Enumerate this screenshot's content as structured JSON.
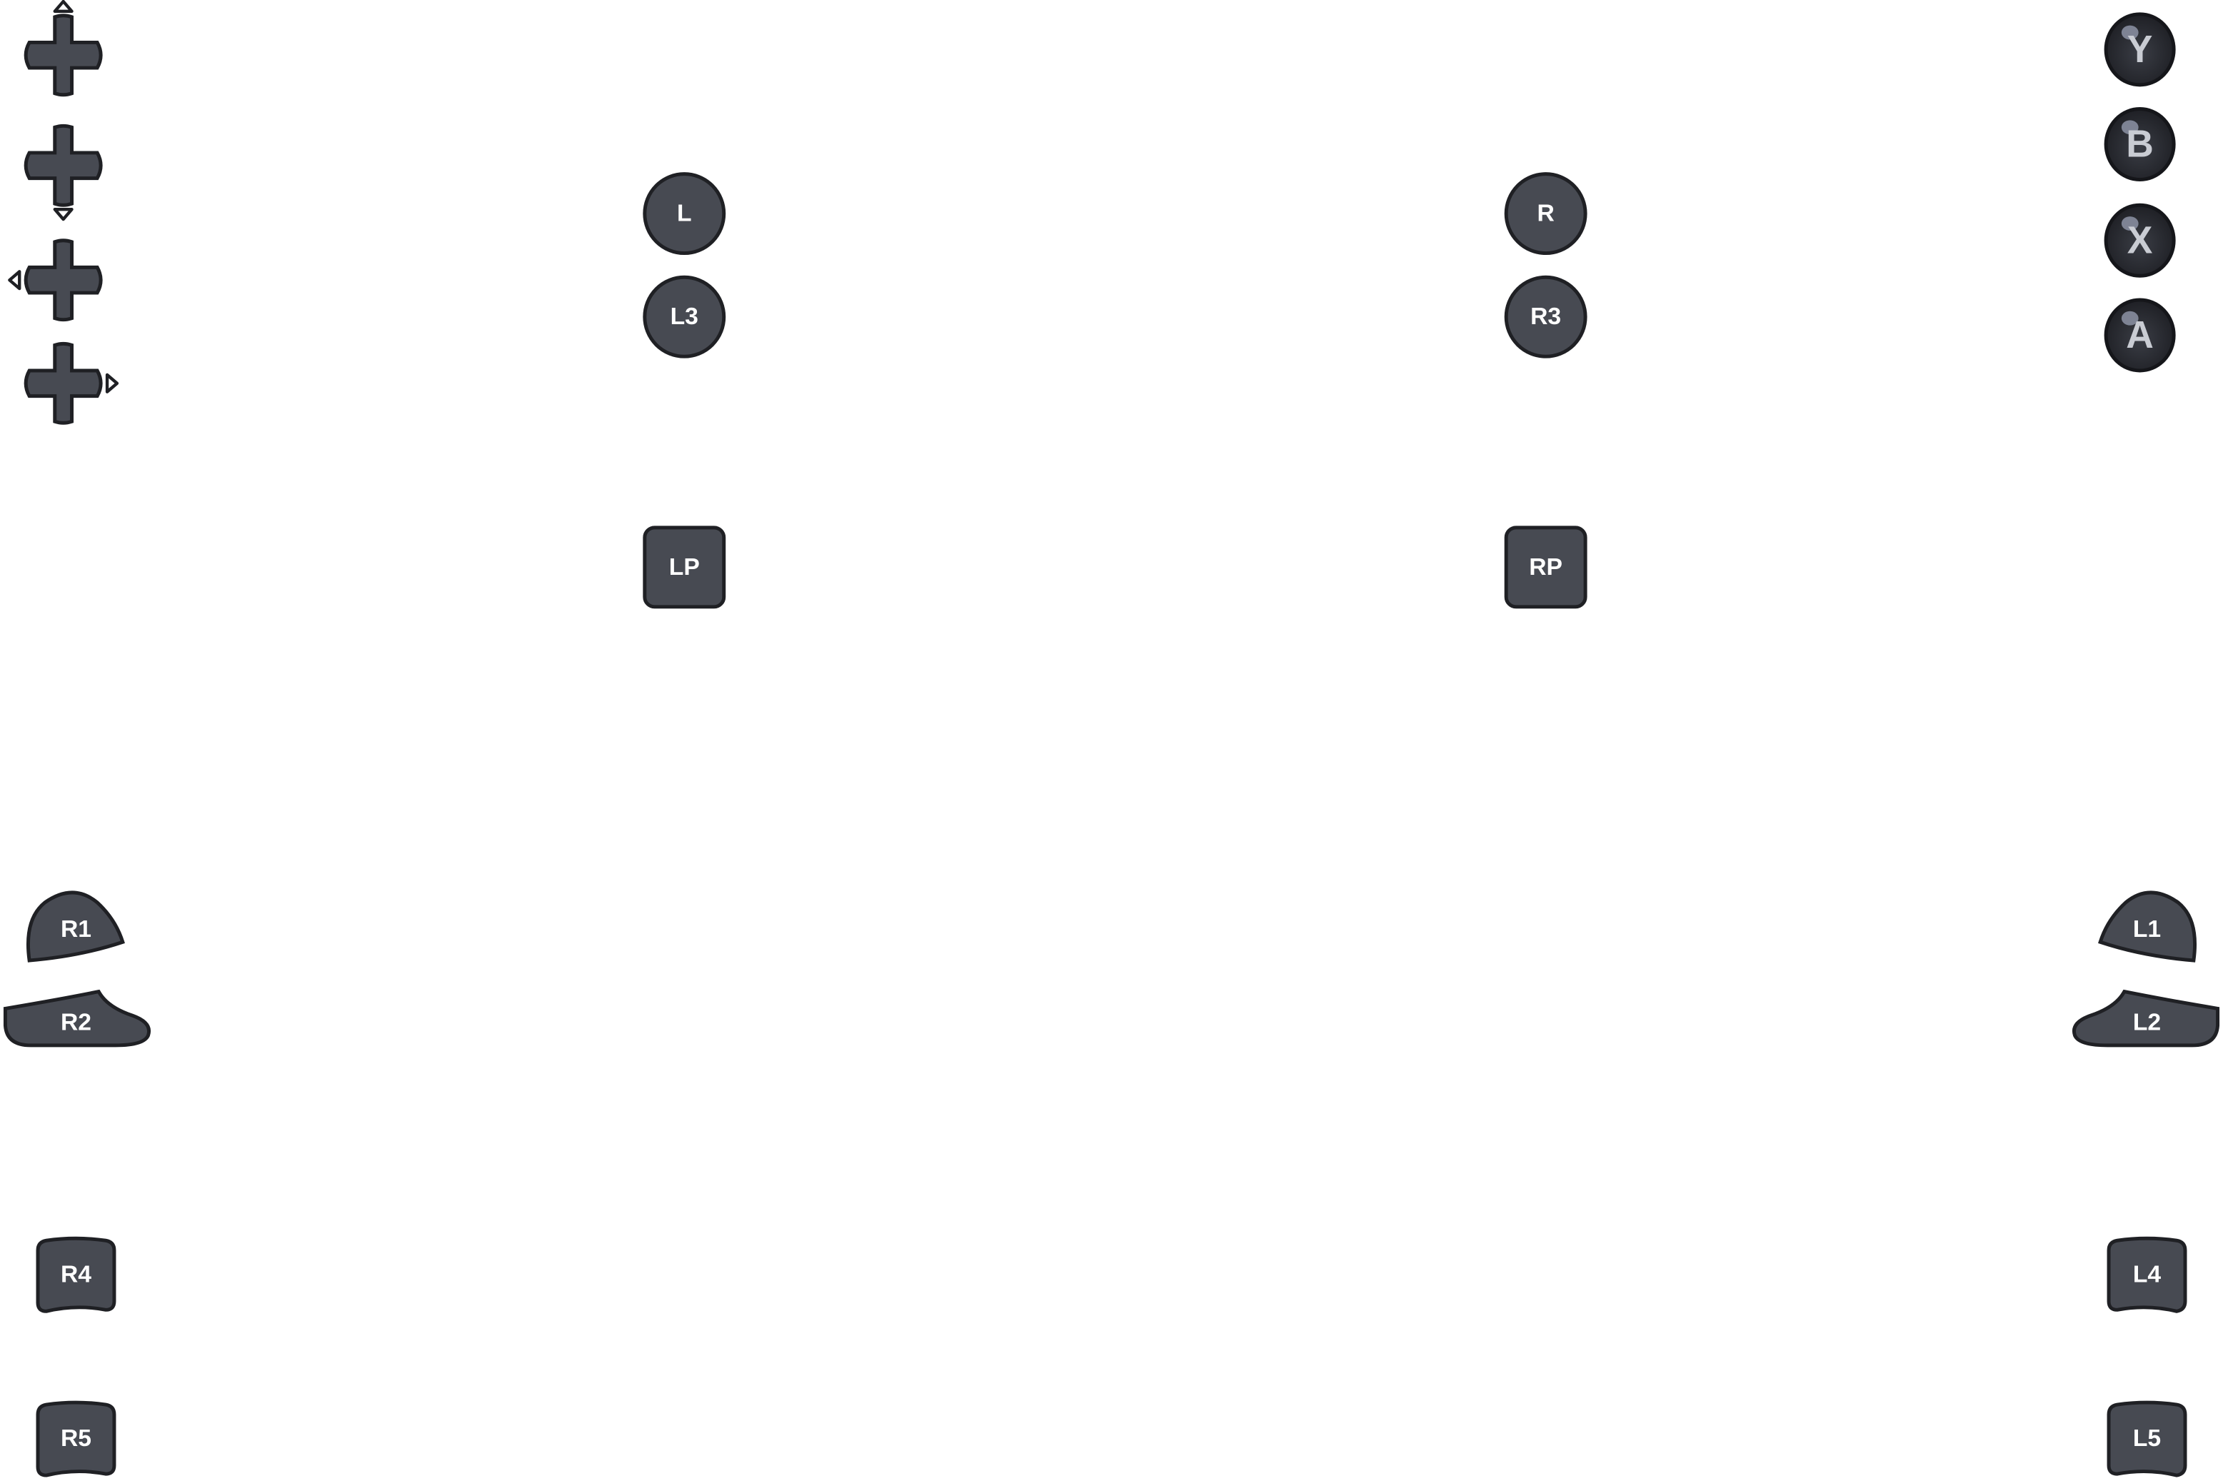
{
  "colors": {
    "button_fill": "#474a52",
    "button_stroke": "#1f2024",
    "face_fill": "#2b2d33",
    "face_label": "#c9ccd3",
    "background": "#ffffff"
  },
  "dpad": {
    "up": {
      "icon": "dpad-up-icon"
    },
    "down": {
      "icon": "dpad-down-icon"
    },
    "left": {
      "icon": "dpad-left-icon"
    },
    "right": {
      "icon": "dpad-right-icon"
    }
  },
  "sticks": {
    "l": "L",
    "l3": "L3",
    "r": "R",
    "r3": "R3"
  },
  "paddles": {
    "lp": "LP",
    "rp": "RP"
  },
  "face_buttons": {
    "y": "Y",
    "b": "B",
    "x": "X",
    "a": "A"
  },
  "bumpers": {
    "r1": "R1",
    "r2": "R2",
    "l1": "L1",
    "l2": "L2"
  },
  "back_buttons": {
    "r4": "R4",
    "r5": "R5",
    "l4": "L4",
    "l5": "L5"
  }
}
